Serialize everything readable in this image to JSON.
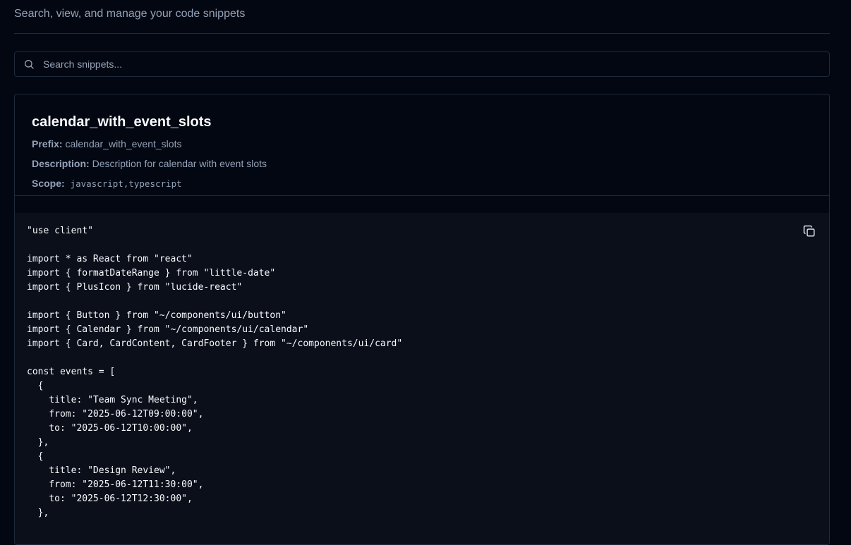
{
  "header": {
    "subtitle": "Search, view, and manage your code snippets"
  },
  "search": {
    "placeholder": "Search snippets...",
    "value": "",
    "icon": "search-icon"
  },
  "snippet": {
    "title": "calendar_with_event_slots",
    "prefix_label": "Prefix:",
    "prefix": "calendar_with_event_slots",
    "description_label": "Description:",
    "description": "Description for calendar with event slots",
    "scope_label": "Scope:",
    "scope": "javascript,typescript",
    "copy_icon": "copy-icon",
    "code": "\"use client\"\n\nimport * as React from \"react\"\nimport { formatDateRange } from \"little-date\"\nimport { PlusIcon } from \"lucide-react\"\n\nimport { Button } from \"~/components/ui/button\"\nimport { Calendar } from \"~/components/ui/calendar\"\nimport { Card, CardContent, CardFooter } from \"~/components/ui/card\"\n\nconst events = [\n  {\n    title: \"Team Sync Meeting\",\n    from: \"2025-06-12T09:00:00\",\n    to: \"2025-06-12T10:00:00\",\n  },\n  {\n    title: \"Design Review\",\n    from: \"2025-06-12T11:30:00\",\n    to: \"2025-06-12T12:30:00\",\n  },"
  },
  "colors": {
    "background": "#030712",
    "border": "#1e293b",
    "code_background": "#0a0f1a",
    "muted_text": "#94a3b8",
    "text": "#f8fafc"
  }
}
